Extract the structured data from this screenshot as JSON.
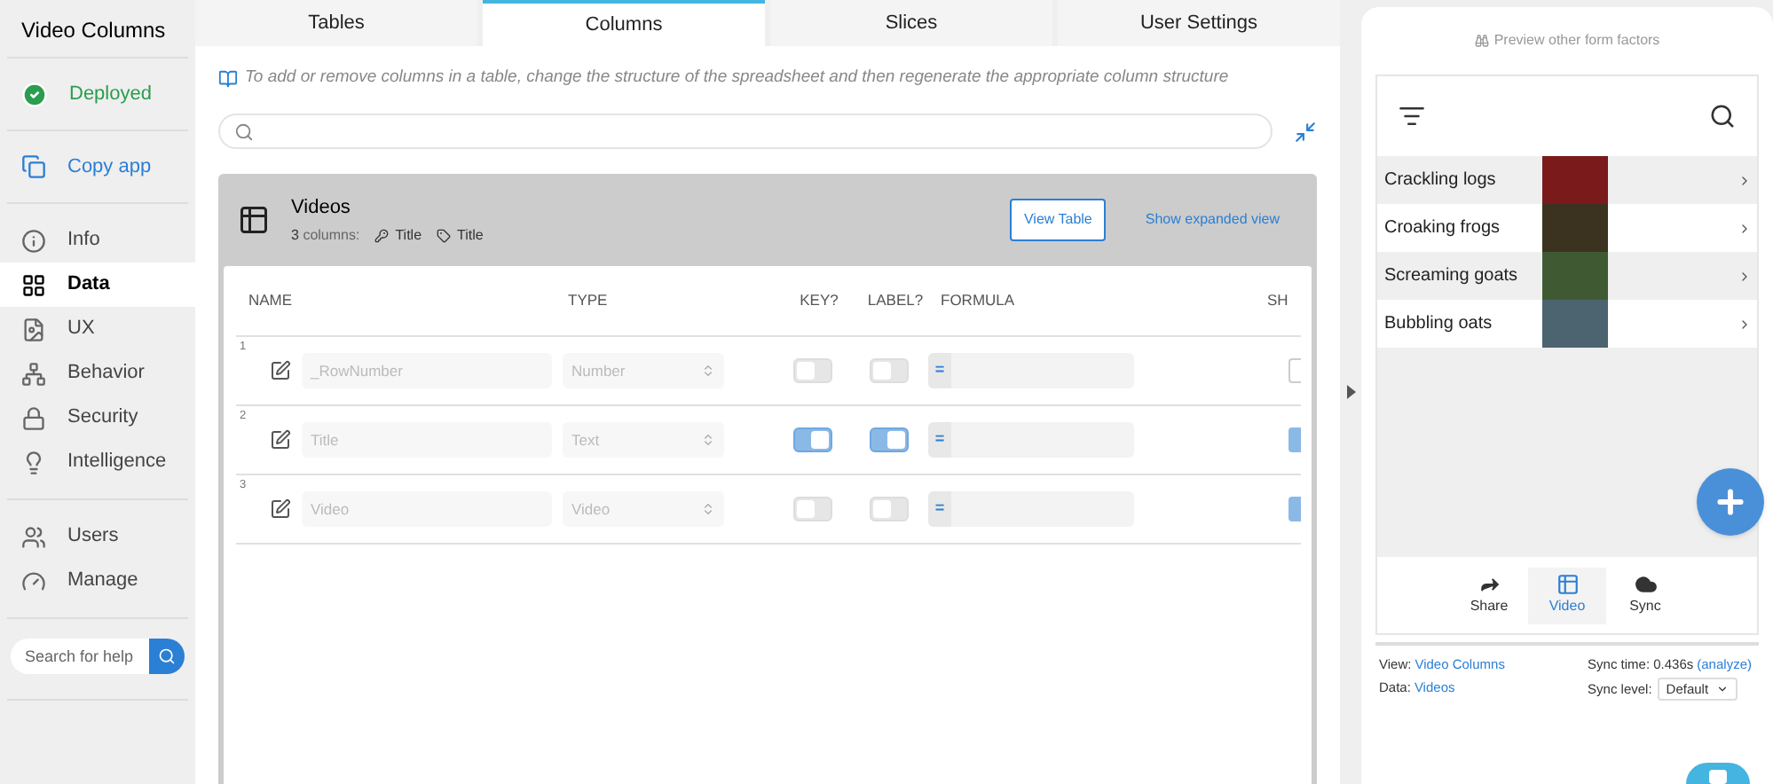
{
  "app_title": "Video Columns",
  "status": {
    "label": "Deployed"
  },
  "copy_action": {
    "label": "Copy app"
  },
  "nav_items": [
    {
      "label": "Info",
      "selected": false
    },
    {
      "label": "Data",
      "selected": true
    },
    {
      "label": "UX",
      "selected": false
    },
    {
      "label": "Behavior",
      "selected": false
    },
    {
      "label": "Security",
      "selected": false
    },
    {
      "label": "Intelligence",
      "selected": false
    }
  ],
  "nav_items_2": [
    {
      "label": "Users",
      "selected": false
    },
    {
      "label": "Manage",
      "selected": false
    }
  ],
  "help_search": {
    "placeholder": "Search for help"
  },
  "tabs": [
    {
      "label": "Tables",
      "selected": false
    },
    {
      "label": "Columns",
      "selected": true
    },
    {
      "label": "Slices",
      "selected": false
    },
    {
      "label": "User Settings",
      "selected": false
    }
  ],
  "hint": "To add or remove columns in a table, change the structure of the spreadsheet and then regenerate the appropriate column structure",
  "table_card": {
    "name": "Videos",
    "count": "3",
    "count_label": "columns:",
    "key_column": "Title",
    "label_column": "Title",
    "view_button": "View Table",
    "expand_link": "Show expanded view",
    "columns": [
      "NAME",
      "TYPE",
      "KEY?",
      "LABEL?",
      "FORMULA",
      "SH"
    ],
    "rows": [
      {
        "number": "1",
        "name": "_RowNumber",
        "type": "Number",
        "key": false,
        "label": false,
        "formula": "=",
        "column_6_checked": false
      },
      {
        "number": "2",
        "name": "Title",
        "type": "Text",
        "key": true,
        "label": true,
        "formula": "=",
        "column_6_checked": true
      },
      {
        "number": "3",
        "name": "Video",
        "type": "Video",
        "key": false,
        "label": false,
        "formula": "=",
        "column_6_checked": true
      }
    ]
  },
  "preview": {
    "title": "Preview other form factors",
    "items": [
      {
        "title": "Crackling logs"
      },
      {
        "title": "Croaking frogs"
      },
      {
        "title": "Screaming goats"
      },
      {
        "title": "Bubbling oats"
      }
    ],
    "bottom_nav": [
      {
        "label": "Share",
        "selected": false
      },
      {
        "label": "Video",
        "selected": true
      },
      {
        "label": "Sync",
        "selected": false
      }
    ],
    "view_label": "View:",
    "view_value": "Video Columns",
    "data_label": "Data:",
    "data_value": "Videos",
    "sync_time_label": "Sync time: 0.436s",
    "analyze_link": "(analyze)",
    "sync_level_label": "Sync level:",
    "sync_level_value": "Default"
  }
}
